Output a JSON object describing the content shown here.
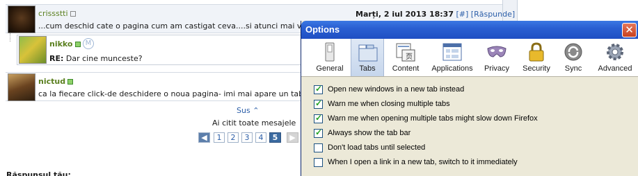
{
  "forum": {
    "posts": [
      {
        "username": "crissstti",
        "text": "...cum deschid cate o pagina cum am castigat ceva....si atunci mai vreti sa mun",
        "date": "Marți, 2 iul 2013 18:37",
        "hash_link": "[#]",
        "reply_link": "[Răspunde]"
      },
      {
        "username": "nikko",
        "badge": "M",
        "re_label": "RE:",
        "text": "Dar cine munceste?"
      },
      {
        "username": "nictud",
        "text": "ca la fiecare click-de deschidere o noua pagina- imi mai apare un tab...    :("
      }
    ],
    "sus_label": "Sus",
    "read_all": "Ai citit toate mesajele",
    "pages": [
      "1",
      "2",
      "3",
      "4",
      "5"
    ],
    "active_page": "5",
    "bottom_heading": "Răspunsul tău:"
  },
  "dialog": {
    "title": "Options",
    "close_glyph": "✕",
    "tabs": [
      {
        "label": "General",
        "icon": "general-icon"
      },
      {
        "label": "Tabs",
        "icon": "tabs-icon"
      },
      {
        "label": "Content",
        "icon": "content-icon"
      },
      {
        "label": "Applications",
        "icon": "applications-icon"
      },
      {
        "label": "Privacy",
        "icon": "privacy-mask-icon"
      },
      {
        "label": "Security",
        "icon": "lock-icon"
      },
      {
        "label": "Sync",
        "icon": "sync-icon"
      },
      {
        "label": "Advanced",
        "icon": "gear-icon"
      }
    ],
    "selected_tab": "Tabs",
    "options": [
      {
        "label": "Open new windows in a new tab instead",
        "checked": true
      },
      {
        "label": "Warn me when closing multiple tabs",
        "checked": true
      },
      {
        "label": "Warn me when opening multiple tabs might slow down Firefox",
        "checked": true
      },
      {
        "label": "Always show the tab bar",
        "checked": true
      },
      {
        "label": "Don't load tabs until selected",
        "checked": false
      },
      {
        "label": "When I open a link in a new tab, switch to it immediately",
        "checked": false
      }
    ]
  },
  "colors": {
    "titlebar": "#2a5fd2",
    "dialog_bg": "#ece9d8",
    "forum_link": "#2b5ea8",
    "checkmark": "#21a121"
  }
}
